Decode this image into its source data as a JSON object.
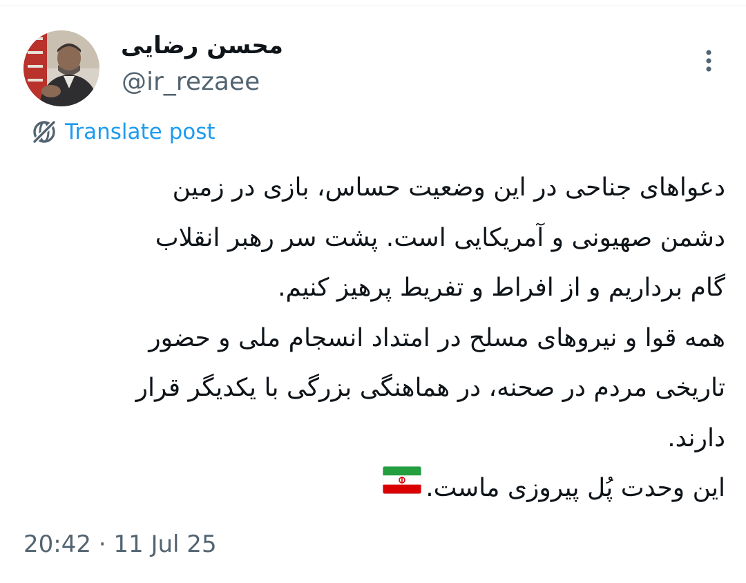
{
  "tweet": {
    "author": {
      "display_name": "محسن رضایی",
      "handle": "@ir_rezaee",
      "avatar_icon": "profile-photo"
    },
    "more_icon": "more-vertical-icon",
    "translate": {
      "icon": "globe-slash-icon",
      "label": "Translate post"
    },
    "lines": [
      "دعواهای جناحی در این وضعیت حساس، بازی در زمین",
      "دشمن صهیونی و آمریکایی است. پشت سر رهبر انقلاب",
      "گام برداریم و از افراط و تفریط پرهیز کنیم.",
      "همه قوا و نیروهای مسلح در امتداد انسجام ملی و حضور",
      "تاریخی مردم در صحنه، در هماهنگی بزرگی با یکدیگر قرار",
      "دارند.",
      "این وحدت پُل پیروزی ماست."
    ],
    "flag_icon": "iran-flag-icon",
    "timestamp": "20:42 · 11 Jul 25",
    "colors": {
      "text": "#0f1419",
      "secondary": "#536471",
      "link": "#1d9bf0"
    }
  }
}
